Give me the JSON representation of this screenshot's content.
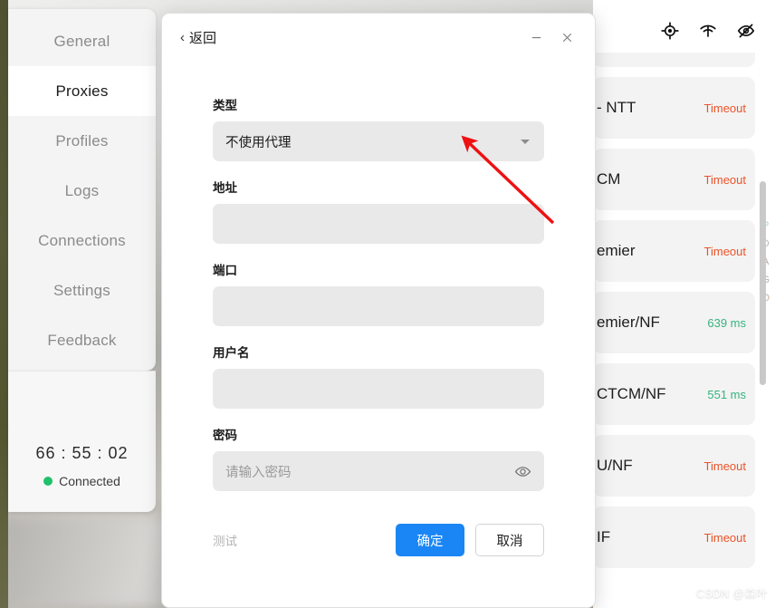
{
  "sidebar": {
    "items": [
      {
        "label": "General",
        "active": false
      },
      {
        "label": "Proxies",
        "active": true
      },
      {
        "label": "Profiles",
        "active": false
      },
      {
        "label": "Logs",
        "active": false
      },
      {
        "label": "Connections",
        "active": false
      },
      {
        "label": "Settings",
        "active": false
      },
      {
        "label": "Feedback",
        "active": false
      }
    ],
    "footer": {
      "timer": "66 : 55 : 02",
      "status": "Connected",
      "status_color": "#1fc16b"
    }
  },
  "toolbar": {
    "icons": [
      {
        "name": "target-icon"
      },
      {
        "name": "wifi-icon"
      },
      {
        "name": "eye-off-icon"
      }
    ]
  },
  "proxy_list": {
    "rows": [
      {
        "name": "",
        "latency": "",
        "state": "partial"
      },
      {
        "name": "- NTT",
        "latency": "Timeout",
        "state": "timeout"
      },
      {
        "name": "CM",
        "latency": "Timeout",
        "state": "timeout"
      },
      {
        "name": "emier",
        "latency": "Timeout",
        "state": "timeout"
      },
      {
        "name": "emier/NF",
        "latency": "639 ms",
        "state": "ok"
      },
      {
        "name": "CTCM/NF",
        "latency": "551 ms",
        "state": "ok"
      },
      {
        "name": "U/NF",
        "latency": "Timeout",
        "state": "timeout"
      },
      {
        "name": "IF",
        "latency": "Timeout",
        "state": "timeout"
      }
    ],
    "alpha_index": [
      {
        "letter": "P",
        "color": "#a9d8bf"
      },
      {
        "letter": "D",
        "color": "#b5b5b5"
      },
      {
        "letter": "A",
        "color": "#b9a9a0"
      },
      {
        "letter": "G",
        "color": "#c0a8bb"
      },
      {
        "letter": "O",
        "color": "#c6b09a"
      }
    ],
    "colors": {
      "timeout": "#e8542a",
      "ok": "#36b37e"
    }
  },
  "dialog": {
    "back_label": "返回",
    "back_chevron": "‹",
    "minimize_label": "最小化",
    "close_label": "关闭",
    "fields": {
      "type": {
        "label": "类型",
        "value": "不使用代理"
      },
      "address": {
        "label": "地址",
        "value": "",
        "placeholder": ""
      },
      "port": {
        "label": "端口",
        "value": "",
        "placeholder": ""
      },
      "username": {
        "label": "用户名",
        "value": "",
        "placeholder": ""
      },
      "password": {
        "label": "密码",
        "value": "",
        "placeholder": "请输入密码"
      }
    },
    "footer": {
      "test_label": "测试",
      "confirm_label": "确定",
      "cancel_label": "取消",
      "primary_color": "#1a86f5"
    }
  },
  "annotation": {
    "arrow_color": "#ee1111"
  },
  "watermark": {
    "text": "CSDN @森叶"
  }
}
